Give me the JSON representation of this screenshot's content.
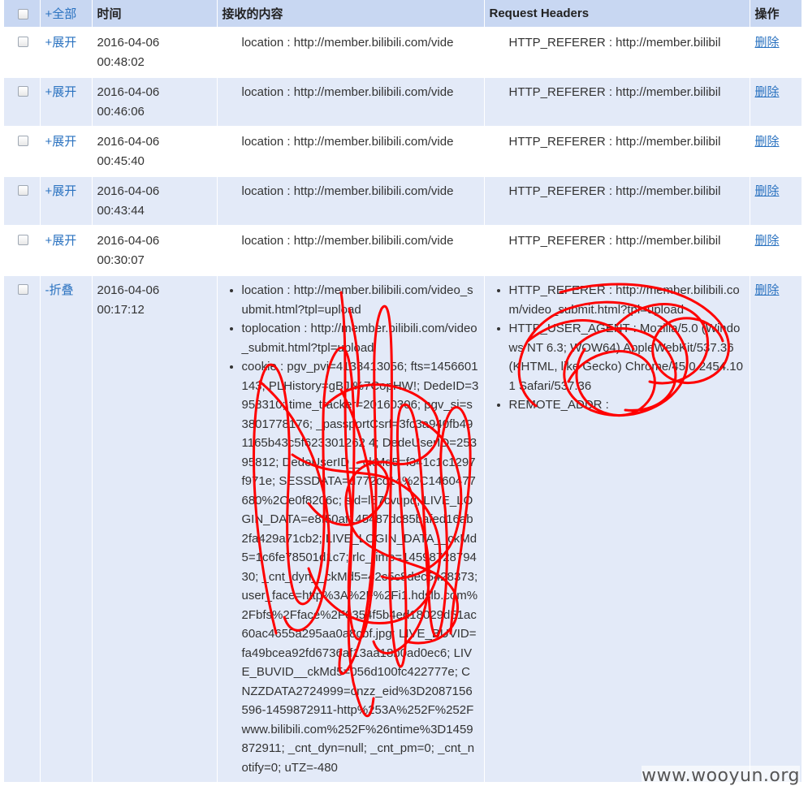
{
  "header": {
    "all_label": "+全部",
    "time_label": "时间",
    "content_label": "接收的内容",
    "headers_label": "Request Headers",
    "ops_label": "操作"
  },
  "rows": [
    {
      "toggle": "+展开",
      "time": "2016-04-06\n00:48:02",
      "content": [
        "location : http://member.bilibili.com/vide"
      ],
      "headers": [
        "HTTP_REFERER : http://member.bilibil"
      ],
      "delete": "删除"
    },
    {
      "toggle": "+展开",
      "time": "2016-04-06\n00:46:06",
      "content": [
        "location : http://member.bilibili.com/vide"
      ],
      "headers": [
        "HTTP_REFERER : http://member.bilibil"
      ],
      "delete": "删除"
    },
    {
      "toggle": "+展开",
      "time": "2016-04-06\n00:45:40",
      "content": [
        "location : http://member.bilibili.com/vide"
      ],
      "headers": [
        "HTTP_REFERER : http://member.bilibil"
      ],
      "delete": "删除"
    },
    {
      "toggle": "+展开",
      "time": "2016-04-06\n00:43:44",
      "content": [
        "location : http://member.bilibili.com/vide"
      ],
      "headers": [
        "HTTP_REFERER : http://member.bilibil"
      ],
      "delete": "删除"
    },
    {
      "toggle": "+展开",
      "time": "2016-04-06\n00:30:07",
      "content": [
        "location : http://member.bilibili.com/vide"
      ],
      "headers": [
        "HTTP_REFERER : http://member.bilibil"
      ],
      "delete": "删除"
    },
    {
      "toggle": "-折叠",
      "time": "2016-04-06\n00:17:12",
      "content": [
        "location : http://member.bilibili.com/video_submit.html?tpl=upload",
        "toplocation : http://member.bilibili.com/video_submit.html?tpl=upload",
        "cookie : pgv_pvi=4138413056; fts=1456601143; PLHistory=gBJI%7CopHW!; DedeID=3958310; time_tracker=20160306; pgv_si=s3801778176; _passportCsrf=3fc3a940fb491165b43c5f623301262 4; DedeUserID=25395812; DedeUserID__ckMd5=f341c1c1297f971e; SESSDATA=d772cc14%2C1460477680%2Ce0f8206c; sid=l57cvupq; LIVE_LOGIN_DATA=e8f50af145487dc85bafed16ab2fa429a71cb2; LIVE_LOGIN_DATA__ckMd5=1c6fe78501d1c7; rlc_time=1459872879430; _cnt_dyn__ckMd5=42c5c8dec5428373; user_face=http%3A%2F%2Fi1.hdslb.com%2Fbfs%2Fface%2F0354f5b4ed18029d51ac60ac4655a295aa0a8cbf.jpg; LIVE_BUVID=fa49bcea92fd6736af13aa18b0ad0ec6; LIVE_BUVID__ckMd5=056d100fc422777e; CNZZDATA2724999=cnzz_eid%3D2087156596-1459872911-http%253A%252F%252Fwww.bilibili.com%252F%26ntime%3D1459872911; _cnt_dyn=null; _cnt_pm=0; _cnt_notify=0; uTZ=-480"
      ],
      "headers": [
        "HTTP_REFERER : http://member.bilibili.com/video_submit.html?tpl=upload",
        "HTTP_USER_AGENT : Mozilla/5.0 (Windows NT 6.3; WOW64) AppleWebKit/537.36 (KHTML, like Gecko) Chrome/45.0.2454.101 Safari/537.36",
        "REMOTE_ADDR :"
      ],
      "delete": "删除"
    }
  ],
  "watermark": "www.wooyun.org",
  "colors": {
    "header_bg": "#c8d7f2",
    "stripe_bg": "#e3eaf8",
    "link": "#2a72c0",
    "scribble": "#ff0000"
  }
}
